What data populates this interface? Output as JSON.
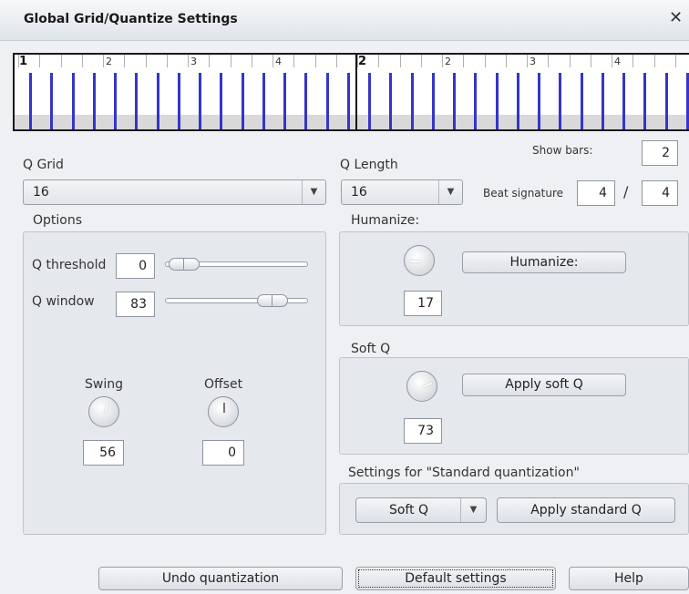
{
  "window": {
    "title": "Global Grid/Quantize Settings",
    "close_glyph": "✕"
  },
  "ruler": {
    "bar_labels": [
      "1",
      "2"
    ],
    "beat_labels": [
      "2",
      "3",
      "4"
    ]
  },
  "q_grid": {
    "label": "Q Grid",
    "value": "16"
  },
  "q_length": {
    "label": "Q Length",
    "value": "16"
  },
  "show_bars": {
    "label": "Show bars:",
    "value": "2"
  },
  "beat_signature": {
    "label": "Beat signature",
    "numerator": "4",
    "separator": "/",
    "denominator": "4"
  },
  "options": {
    "label": "Options",
    "q_threshold": {
      "label": "Q threshold",
      "value": "0"
    },
    "q_window": {
      "label": "Q window",
      "value": "83"
    },
    "swing": {
      "label": "Swing",
      "value": "56"
    },
    "offset": {
      "label": "Offset",
      "value": "0"
    }
  },
  "humanize": {
    "label": "Humanize:",
    "button": "Humanize:",
    "value": "17"
  },
  "soft_q": {
    "label": "Soft Q",
    "button": "Apply soft Q",
    "value": "73"
  },
  "standard": {
    "label": "Settings for \"Standard quantization\"",
    "mode": "Soft Q",
    "button": "Apply standard Q"
  },
  "footer": {
    "undo": "Undo quantization",
    "defaults": "Default settings",
    "help": "Help"
  },
  "colors": {
    "accent": "#3535c8",
    "window_bg": "#eef0f3"
  }
}
